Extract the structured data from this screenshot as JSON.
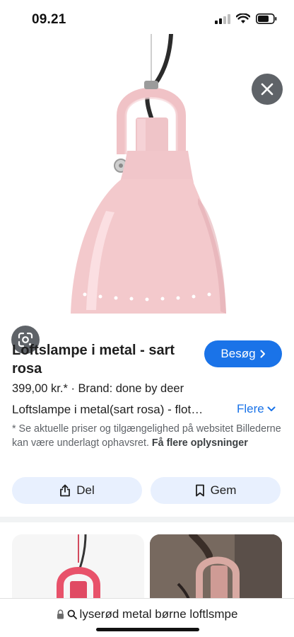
{
  "status": {
    "time": "09.21",
    "icons": [
      "signal-icon",
      "wifi-icon",
      "battery-icon"
    ]
  },
  "hero": {
    "image": "pink metal pendant lamp",
    "close_icon": "close-icon",
    "lens_icon": "google-lens-icon"
  },
  "product": {
    "title": "Loftslampe i metal - sart rosa",
    "visit_label": "Besøg",
    "price_brand": "399,00 kr.* · Brand: done by deer",
    "description": "Loftslampe i metal(sart rosa) - flot…",
    "more_label": "Flere",
    "disclaimer": "* Se aktuelle priser og tilgængelighed på websitet Billederne kan være underlagt ophavsret.",
    "disclaimer_link": "Få flere oplysninger"
  },
  "actions": {
    "share_label": "Del",
    "save_label": "Gem"
  },
  "bottom": {
    "url_text": "lyserød metal børne loftlsmpe"
  },
  "colors": {
    "accent": "#1a73e8",
    "chip_bg": "#e8f0fe",
    "lamp_pink": "#f3c9cc"
  }
}
